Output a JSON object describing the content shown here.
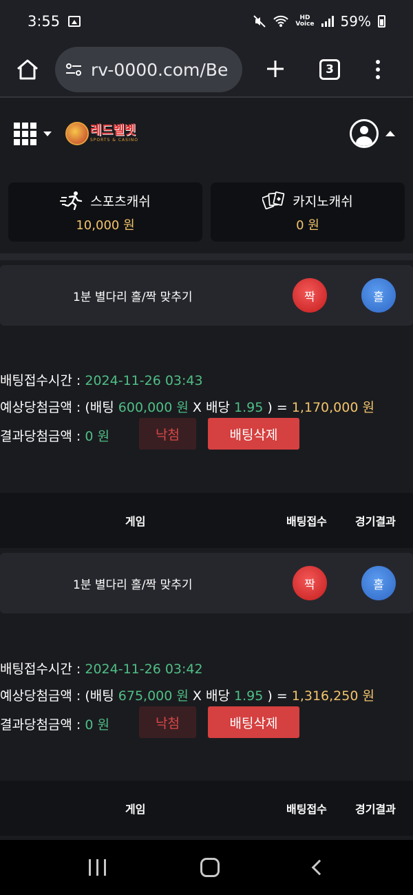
{
  "status_bar": {
    "time": "3:55",
    "battery": "59%",
    "hd_label": "HD",
    "voice_label": "Voice"
  },
  "browser": {
    "url": "rv-0000.com/Be",
    "tab_count": "3"
  },
  "header": {
    "logo_text": "레드벨벳",
    "logo_sub": "SPORTS & CASINO"
  },
  "wallets": [
    {
      "label": "스포츠캐쉬",
      "amount": "10,000 원",
      "icon": "running-person-icon"
    },
    {
      "label": "카지노캐쉬",
      "amount": "0 원",
      "icon": "playing-cards-icon"
    }
  ],
  "bets": [
    {
      "game": "1분 별다리 홀/짝 맞추기",
      "pick_even": "짝",
      "pick_odd": "홀",
      "time_label": "배팅접수시간 : ",
      "time_value": "2024-11-26 03:43",
      "expected_label": "예상당첨금액 : (배팅 ",
      "bet_amount": "600,000 원",
      "odds_label": " X 배당 ",
      "odds": "1.95",
      "eq": " ) = ",
      "expected_win": "1,170,000 원",
      "result_label": "결과당첨금액 : ",
      "result_value": "0 원",
      "status": "낙첨",
      "delete_label": "배팅삭제"
    },
    {
      "game": "1분 별다리 홀/짝 맞추기",
      "pick_even": "짝",
      "pick_odd": "홀",
      "time_label": "배팅접수시간 : ",
      "time_value": "2024-11-26 03:42",
      "expected_label": "예상당첨금액 : (배팅 ",
      "bet_amount": "675,000 원",
      "odds_label": " X 배당 ",
      "odds": "1.95",
      "eq": " ) = ",
      "expected_win": "1,316,250 원",
      "result_label": "결과당첨금액 : ",
      "result_value": "0 원",
      "status": "낙첨",
      "delete_label": "배팅삭제"
    }
  ],
  "table_head": {
    "game": "게임",
    "bet_received": "배팅접수",
    "match_result": "경기결과"
  },
  "colors": {
    "accent_green": "#4fbf86",
    "accent_yellow": "#f2c46b",
    "danger_red": "#d54040",
    "odd_blue": "#3f7ad6"
  }
}
